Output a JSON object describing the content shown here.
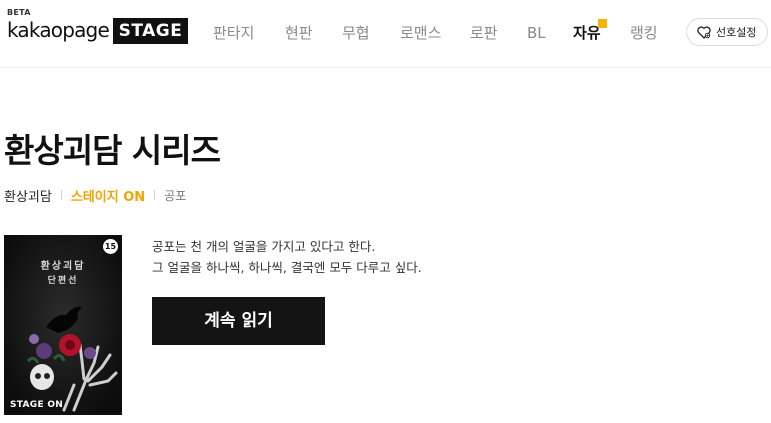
{
  "logo": {
    "beta": "BETA",
    "word": "kakaopage",
    "stage": "STAGE"
  },
  "nav": {
    "items": [
      {
        "label": "판타지"
      },
      {
        "label": "현판"
      },
      {
        "label": "무협"
      },
      {
        "label": "로맨스"
      },
      {
        "label": "로판"
      },
      {
        "label": "BL"
      },
      {
        "label": "자유",
        "active": true
      },
      {
        "label": "랭킹"
      }
    ],
    "active_dot_color": "#f5b400"
  },
  "preference": {
    "label": "선호설정",
    "icon": "heart-icon"
  },
  "work": {
    "title": "환상괴담 시리즈",
    "author": "환상괴담",
    "platform": "스테이지 ON",
    "genre": "공포",
    "description": [
      "공포는 천 개의 얼굴을 가지고 있다고 한다.",
      "그 얼굴을 하나씩, 하나씩, 결국엔 모두 다루고 싶다."
    ],
    "read_button": "계속 읽기"
  },
  "cover": {
    "badge": "15",
    "title_line1": "환상괴담",
    "title_line2": "단편선",
    "brand": "STAGE ON"
  },
  "colors": {
    "accent": "#f2a400",
    "button": "#141414"
  }
}
